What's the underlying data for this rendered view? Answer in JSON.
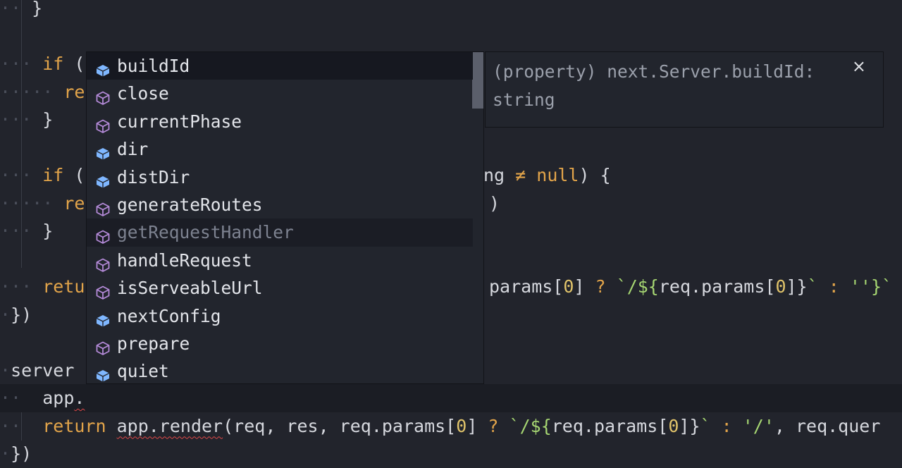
{
  "editor": {
    "lines": [
      {
        "id": "l1",
        "dots": "··",
        "parts": [
          {
            "t": " }",
            "c": "pun"
          }
        ]
      },
      {
        "id": "l2",
        "dots": "",
        "parts": []
      },
      {
        "id": "l3",
        "dots": "···",
        "parts": [
          {
            "t": " if",
            "c": "kw"
          },
          {
            "t": " (",
            "c": "pun"
          }
        ]
      },
      {
        "id": "l4",
        "dots": "·····",
        "parts": [
          {
            "t": " re",
            "c": "kw"
          }
        ]
      },
      {
        "id": "l5",
        "dots": "···",
        "parts": [
          {
            "t": " }",
            "c": "pun"
          }
        ]
      },
      {
        "id": "l6",
        "dots": "",
        "parts": []
      },
      {
        "id": "l7",
        "dots": "···",
        "parts": [
          {
            "t": " if",
            "c": "kw"
          },
          {
            "t": " (",
            "c": "pun"
          }
        ]
      },
      {
        "id": "l8",
        "dots": "·····",
        "parts": [
          {
            "t": " re",
            "c": "kw"
          }
        ]
      },
      {
        "id": "l9",
        "dots": "···",
        "parts": [
          {
            "t": " }",
            "c": "pun"
          }
        ]
      },
      {
        "id": "l10",
        "dots": "",
        "parts": []
      },
      {
        "id": "l11",
        "dots": "···",
        "parts": [
          {
            "t": " retu",
            "c": "kw"
          }
        ]
      },
      {
        "id": "l12",
        "dots": "·",
        "parts": [
          {
            "t": "})",
            "c": "pun"
          }
        ]
      },
      {
        "id": "l13",
        "dots": "",
        "parts": []
      },
      {
        "id": "l14",
        "dots": "·",
        "parts": [
          {
            "t": "server",
            "c": "plain"
          }
        ]
      }
    ],
    "right_fragments": {
      "r7": [
        {
          "t": "ng ",
          "c": "plain"
        },
        {
          "t": "≠",
          "c": "kw"
        },
        {
          "t": " null",
          "c": "kw"
        },
        {
          "t": ") {",
          "c": "pun"
        }
      ],
      "r8": [
        {
          "t": ")",
          "c": "pun"
        }
      ],
      "r11": [
        {
          "t": "params[",
          "c": "plain"
        },
        {
          "t": "0",
          "c": "num"
        },
        {
          "t": "] ",
          "c": "plain"
        },
        {
          "t": "?",
          "c": "kw"
        },
        {
          "t": " `/${",
          "c": "str"
        },
        {
          "t": "req.params[",
          "c": "plain"
        },
        {
          "t": "0",
          "c": "num"
        },
        {
          "t": "]}",
          "c": "plain"
        },
        {
          "t": "`",
          "c": "str"
        },
        {
          "t": " : ",
          "c": "kw"
        },
        {
          "t": "''",
          "c": "str"
        },
        {
          "t": "}`",
          "c": "str"
        }
      ]
    },
    "current_line": {
      "dots": "··",
      "prefix": "app",
      "dot": "."
    },
    "return_line": [
      {
        "t": "return",
        "c": "kw"
      },
      {
        "t": " ",
        "c": "plain"
      },
      {
        "t": "app.render",
        "c": "plain squig"
      },
      {
        "t": "(req, res, req.params[",
        "c": "plain"
      },
      {
        "t": "0",
        "c": "num"
      },
      {
        "t": "] ",
        "c": "plain"
      },
      {
        "t": "?",
        "c": "kw"
      },
      {
        "t": " `/${",
        "c": "str"
      },
      {
        "t": "req.params[",
        "c": "plain"
      },
      {
        "t": "0",
        "c": "num"
      },
      {
        "t": "]}",
        "c": "plain"
      },
      {
        "t": "`",
        "c": "str"
      },
      {
        "t": " : ",
        "c": "kw"
      },
      {
        "t": "'/'",
        "c": "str"
      },
      {
        "t": ", req.quer",
        "c": "plain"
      }
    ],
    "return_dots": "··",
    "last_line": {
      "dots": "·",
      "text": "})"
    }
  },
  "autocomplete": {
    "items": [
      {
        "label": "buildId",
        "kind": "field",
        "state": "selected"
      },
      {
        "label": "close",
        "kind": "method",
        "state": ""
      },
      {
        "label": "currentPhase",
        "kind": "method",
        "state": ""
      },
      {
        "label": "dir",
        "kind": "field",
        "state": ""
      },
      {
        "label": "distDir",
        "kind": "field",
        "state": ""
      },
      {
        "label": "generateRoutes",
        "kind": "method",
        "state": ""
      },
      {
        "label": "getRequestHandler",
        "kind": "method",
        "state": "hover"
      },
      {
        "label": "handleRequest",
        "kind": "method",
        "state": ""
      },
      {
        "label": "isServeableUrl",
        "kind": "method",
        "state": ""
      },
      {
        "label": "nextConfig",
        "kind": "field",
        "state": ""
      },
      {
        "label": "prepare",
        "kind": "method",
        "state": ""
      },
      {
        "label": "quiet",
        "kind": "field",
        "state": ""
      }
    ]
  },
  "detail": {
    "text": "(property) next.Server.buildId:\nstring",
    "close_label": "×"
  },
  "colors": {
    "field_icon": "#7fb7ff",
    "method_icon": "#b48ad8",
    "keyword": "#e2a44a"
  }
}
